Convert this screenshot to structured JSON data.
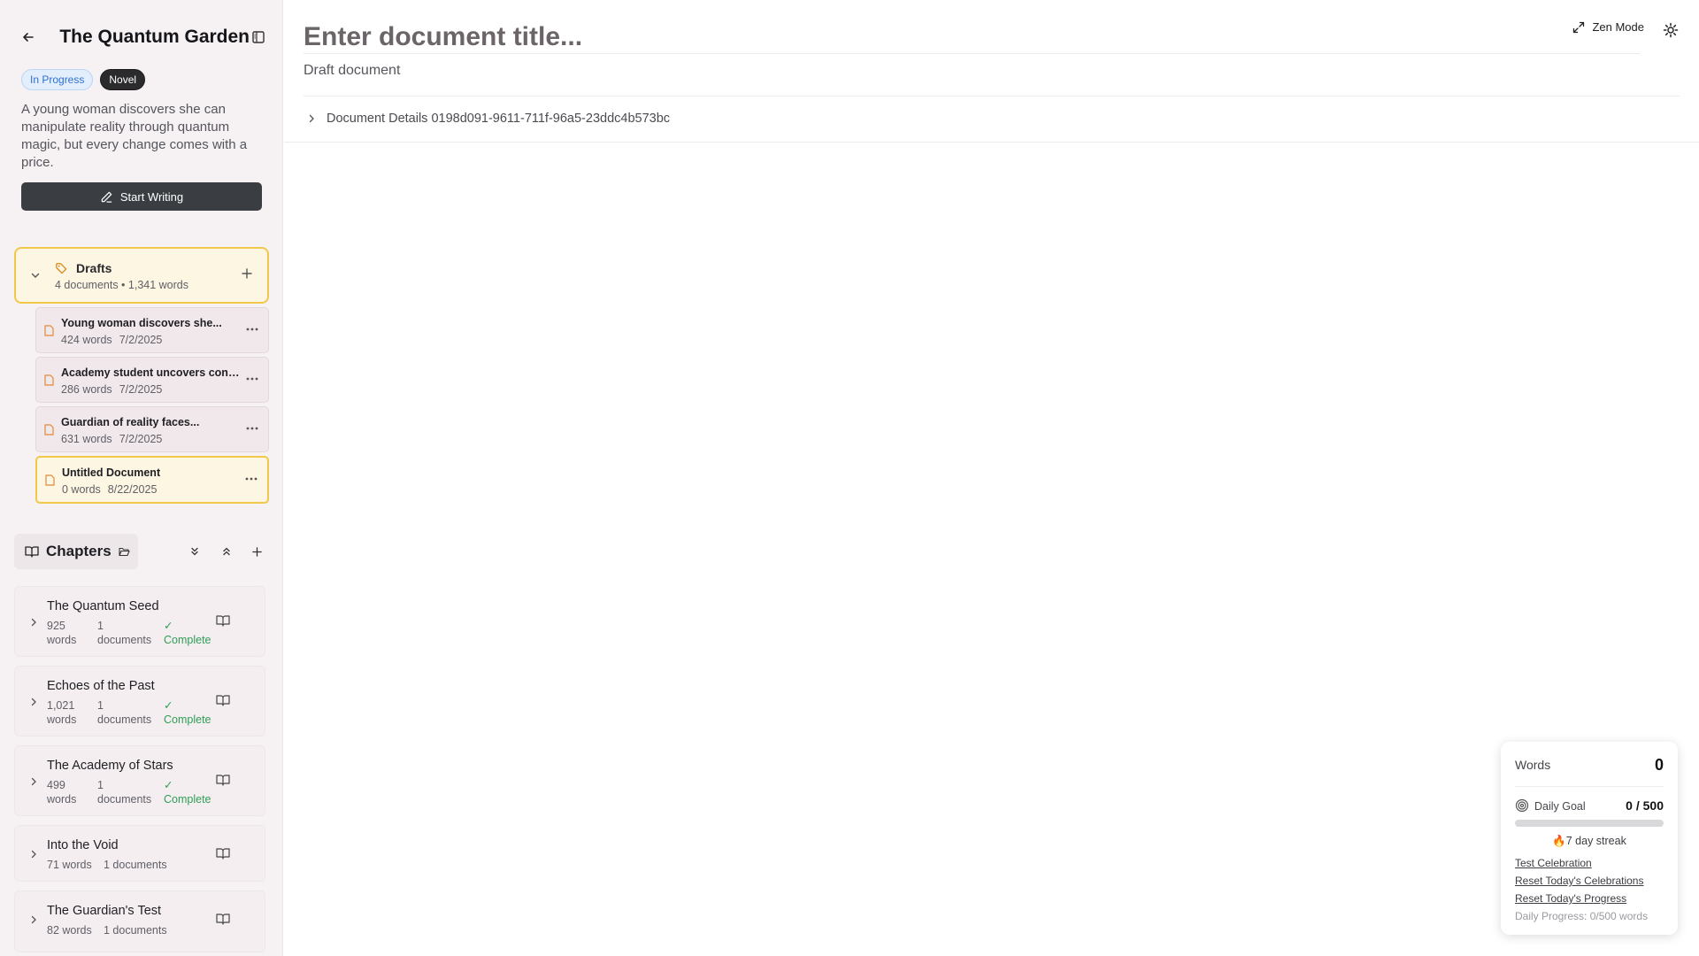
{
  "project": {
    "title": "The Quantum Garden",
    "status_badge": "In Progress",
    "type_badge": "Novel",
    "description": "A young woman discovers she can manipulate reality through quantum magic, but every change comes with a price.",
    "start_writing_label": "Start Writing"
  },
  "drafts": {
    "title": "Drafts",
    "meta": "4 documents • 1,341 words",
    "items": [
      {
        "title": "Young woman discovers she...",
        "words": "424 words",
        "date": "7/2/2025"
      },
      {
        "title": "Academy student uncovers consp...",
        "words": "286 words",
        "date": "7/2/2025"
      },
      {
        "title": "Guardian of reality faces...",
        "words": "631 words",
        "date": "7/2/2025"
      },
      {
        "title": "Untitled Document",
        "words": "0 words",
        "date": "8/22/2025"
      }
    ]
  },
  "chapters": {
    "title": "Chapters",
    "items": [
      {
        "title": "The Quantum Seed",
        "words_num": "925",
        "words_unit": "words",
        "docs_num": "1",
        "docs_unit": "documents",
        "status_mark": "✓",
        "status": "Complete"
      },
      {
        "title": "Echoes of the Past",
        "words_num": "1,021",
        "words_unit": "words",
        "docs_num": "1",
        "docs_unit": "documents",
        "status_mark": "✓",
        "status": "Complete"
      },
      {
        "title": "The Academy of Stars",
        "words_num": "499",
        "words_unit": "words",
        "docs_num": "1",
        "docs_unit": "documents",
        "status_mark": "✓",
        "status": "Complete"
      },
      {
        "title": "Into the Void",
        "words": "71 words",
        "docs": "1 documents"
      },
      {
        "title": "The Guardian's Test",
        "words": "82 words",
        "docs": "1 documents"
      }
    ]
  },
  "editor": {
    "title_placeholder": "Enter document title...",
    "subtitle": "Draft document",
    "zen_label": "Zen Mode",
    "details_label": "Document Details 0198d091-9611-711f-96a5-23ddc4b573bc"
  },
  "widget": {
    "words_label": "Words",
    "words_value": "0",
    "goal_label": "Daily Goal",
    "goal_value": "0 / 500",
    "goal_progress": 0,
    "streak": "🔥7 day streak",
    "link_celebration": "Test Celebration",
    "link_reset_celebrations": "Reset Today's Celebrations",
    "link_reset_progress": "Reset Today's Progress",
    "progress_text": "Daily Progress: 0/500 words"
  },
  "colors": {
    "accent_yellow": "#f2c84b",
    "complete_green": "#2f9e55",
    "badge_blue": "#2f6fd0",
    "dark_button": "#3a3d42"
  }
}
